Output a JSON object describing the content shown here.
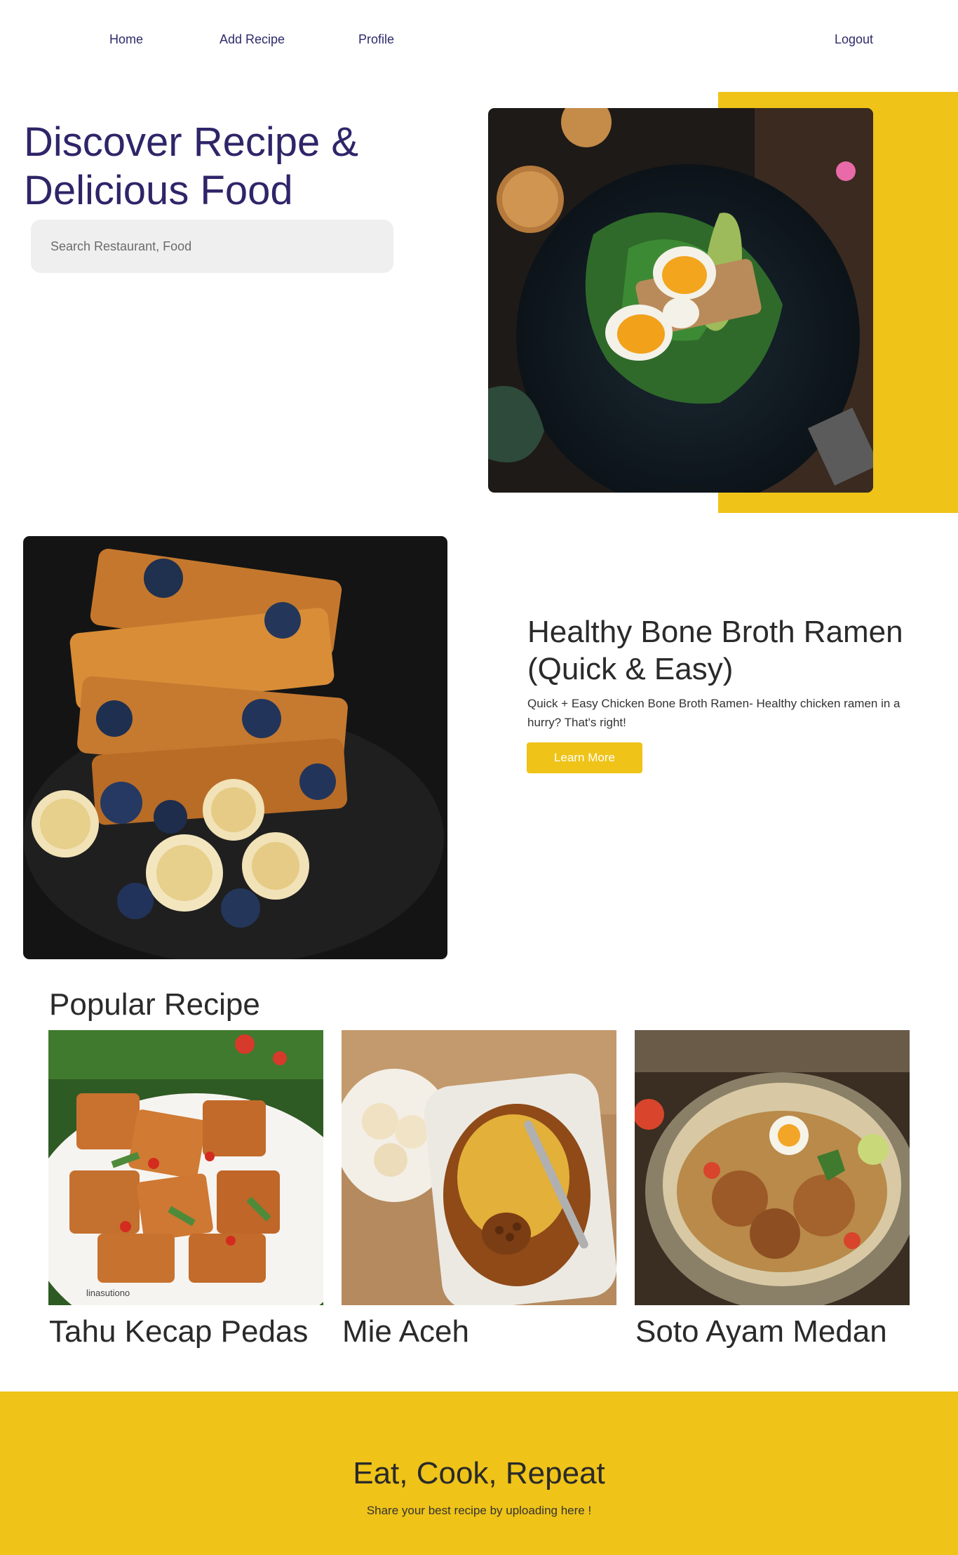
{
  "nav": {
    "home": "Home",
    "add_recipe": "Add Recipe",
    "profile": "Profile",
    "logout": "Logout"
  },
  "hero": {
    "title": "Discover Recipe & Delicious Food",
    "search_placeholder": "Search Restaurant, Food"
  },
  "feature": {
    "title": "Healthy Bone Broth Ramen (Quick & Easy)",
    "description": "Quick + Easy Chicken Bone Broth Ramen- Healthy chicken ramen in a hurry? That's right!",
    "button_label": "Learn More"
  },
  "popular": {
    "title": "Popular Recipe",
    "items": [
      {
        "title": "Tahu Kecap Pedas",
        "watermark": "linasutiono"
      },
      {
        "title": "Mie Aceh"
      },
      {
        "title": "Soto Ayam Medan"
      }
    ]
  },
  "footer": {
    "title": "Eat, Cook, Repeat",
    "subtitle": "Share your best recipe by uploading here !"
  },
  "colors": {
    "accent_yellow": "#efc318",
    "heading_purple": "#2e2569",
    "text_dark": "#2a2a2a"
  }
}
